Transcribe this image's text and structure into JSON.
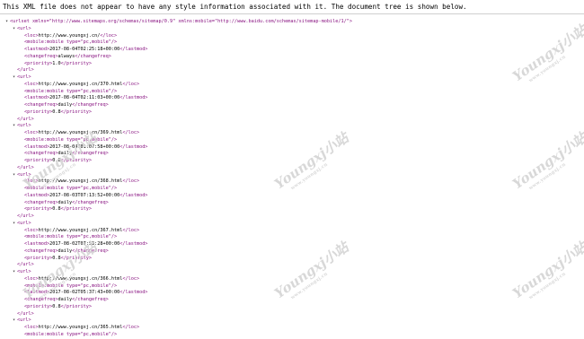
{
  "notice": "This XML file does not appear to have any style information associated with it. The document tree is shown below.",
  "root_open": "<urlset xmlns=\"http://www.sitemaps.org/schemas/sitemap/0.9\" xmlns:mobile=\"http://www.baidu.com/schemas/sitemap-mobile/1/\">",
  "urls": [
    {
      "loc": "http://www.youngxj.cn/",
      "lastmod": "2017-08-04T02:25:18+00:00",
      "changefreq": "always",
      "priority": "1.0"
    },
    {
      "loc": "http://www.youngxj.cn/370.html",
      "lastmod": "2017-08-04T02:11:03+00:00",
      "changefreq": "daily",
      "priority": "0.8"
    },
    {
      "loc": "http://www.youngxj.cn/369.html",
      "lastmod": "2017-08-04T01:07:58+00:00",
      "changefreq": "daily",
      "priority": "0.8"
    },
    {
      "loc": "http://www.youngxj.cn/368.html",
      "lastmod": "2017-08-03T07:13:52+00:00",
      "changefreq": "daily",
      "priority": "0.8"
    },
    {
      "loc": "http://www.youngxj.cn/367.html",
      "lastmod": "2017-08-02T07:53:28+00:00",
      "changefreq": "daily",
      "priority": "0.8"
    },
    {
      "loc": "http://www.youngxj.cn/366.html",
      "lastmod": "2017-08-02T05:37:43+00:00",
      "changefreq": "daily",
      "priority": "0.8"
    },
    {
      "loc": "http://www.youngxj.cn/365.html",
      "lastmod": "",
      "changefreq": "",
      "priority": ""
    }
  ],
  "mobile_tag": "<mobile:mobile type=\"pc,mobile\"/>",
  "watermark": {
    "text": "Youngxj小站",
    "sub": "www.youngxj.cn"
  }
}
